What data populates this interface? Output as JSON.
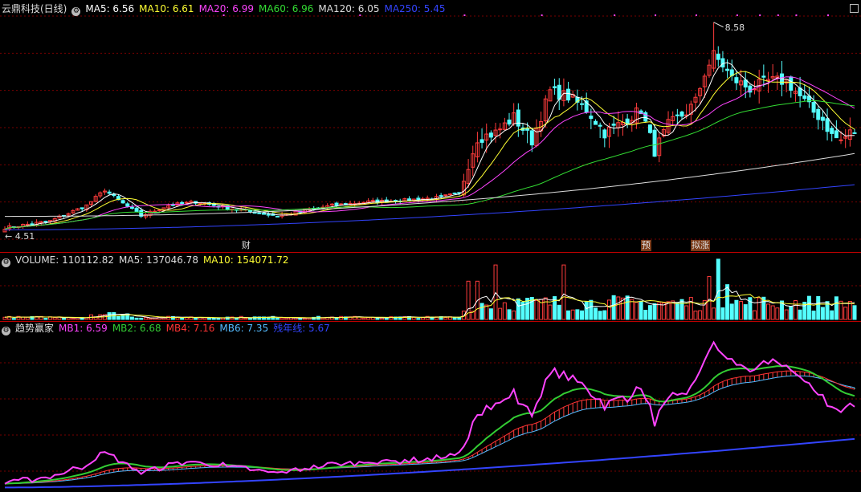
{
  "panels": {
    "price": {
      "title": "云鼎科技(日线)",
      "indicators": [
        {
          "label": "MA5: 6.56",
          "color": "#ffffff"
        },
        {
          "label": "MA10: 6.61",
          "color": "#ffff33"
        },
        {
          "label": "MA20: 6.99",
          "color": "#ff44ff"
        },
        {
          "label": "MA60: 6.96",
          "color": "#33dd33"
        },
        {
          "label": "MA120: 6.05",
          "color": "#dddddd"
        },
        {
          "label": "MA250: 5.45",
          "color": "#3344ff"
        }
      ],
      "high_label": "8.58",
      "low_label": "4.51"
    },
    "volume": {
      "indicators": [
        {
          "label": "VOLUME: 110112.82",
          "color": "#dddddd"
        },
        {
          "label": "MA5: 137046.78",
          "color": "#dddddd"
        },
        {
          "label": "MA10: 154071.72",
          "color": "#ffff33"
        }
      ]
    },
    "trend": {
      "title": "趋势赢家",
      "indicators": [
        {
          "label": "MB1: 6.59",
          "color": "#ff44ff"
        },
        {
          "label": "MB2: 6.68",
          "color": "#33cc33"
        },
        {
          "label": "MB4: 7.16",
          "color": "#ff3333"
        },
        {
          "label": "MB6: 7.35",
          "color": "#55bbff"
        },
        {
          "label": "残年线: 5.67",
          "color": "#3344ff"
        }
      ]
    }
  },
  "markers": [
    {
      "label": "财",
      "index": 53
    },
    {
      "label": "预",
      "index": 141
    },
    {
      "label": "拟涨",
      "index": 152
    }
  ],
  "chart_data": {
    "type": "candlestick",
    "num_days": 188,
    "price_range": [
      4.4,
      8.7
    ],
    "price_keypoints": [
      [
        0,
        4.62
      ],
      [
        10,
        4.75
      ],
      [
        18,
        5.05
      ],
      [
        22,
        5.35
      ],
      [
        25,
        5.15
      ],
      [
        30,
        4.85
      ],
      [
        36,
        5.05
      ],
      [
        42,
        5.12
      ],
      [
        48,
        5.02
      ],
      [
        55,
        4.92
      ],
      [
        60,
        4.85
      ],
      [
        66,
        4.95
      ],
      [
        72,
        5.05
      ],
      [
        80,
        5.12
      ],
      [
        88,
        5.15
      ],
      [
        95,
        5.2
      ],
      [
        100,
        5.28
      ],
      [
        102,
        5.85
      ],
      [
        104,
        6.35
      ],
      [
        108,
        6.45
      ],
      [
        112,
        6.75
      ],
      [
        116,
        6.3
      ],
      [
        120,
        7.25
      ],
      [
        124,
        7.15
      ],
      [
        128,
        6.9
      ],
      [
        132,
        6.45
      ],
      [
        136,
        6.65
      ],
      [
        140,
        6.9
      ],
      [
        143,
        6.1
      ],
      [
        146,
        6.6
      ],
      [
        150,
        6.85
      ],
      [
        152,
        7.05
      ],
      [
        154,
        7.6
      ],
      [
        156,
        7.95
      ],
      [
        158,
        7.75
      ],
      [
        160,
        7.5
      ],
      [
        164,
        7.3
      ],
      [
        168,
        7.45
      ],
      [
        172,
        7.45
      ],
      [
        175,
        7.15
      ],
      [
        178,
        6.85
      ],
      [
        180,
        6.7
      ],
      [
        182,
        6.4
      ],
      [
        184,
        6.3
      ],
      [
        186,
        6.45
      ],
      [
        187,
        6.48
      ]
    ],
    "ma250_range": [
      4.58,
      5.45
    ],
    "ma120_range": [
      4.84,
      6.05
    ],
    "volume_range": [
      0,
      540000
    ],
    "trend_range": [
      4.45,
      8.2
    ],
    "trend_long_range": [
      4.5,
      5.67
    ]
  }
}
